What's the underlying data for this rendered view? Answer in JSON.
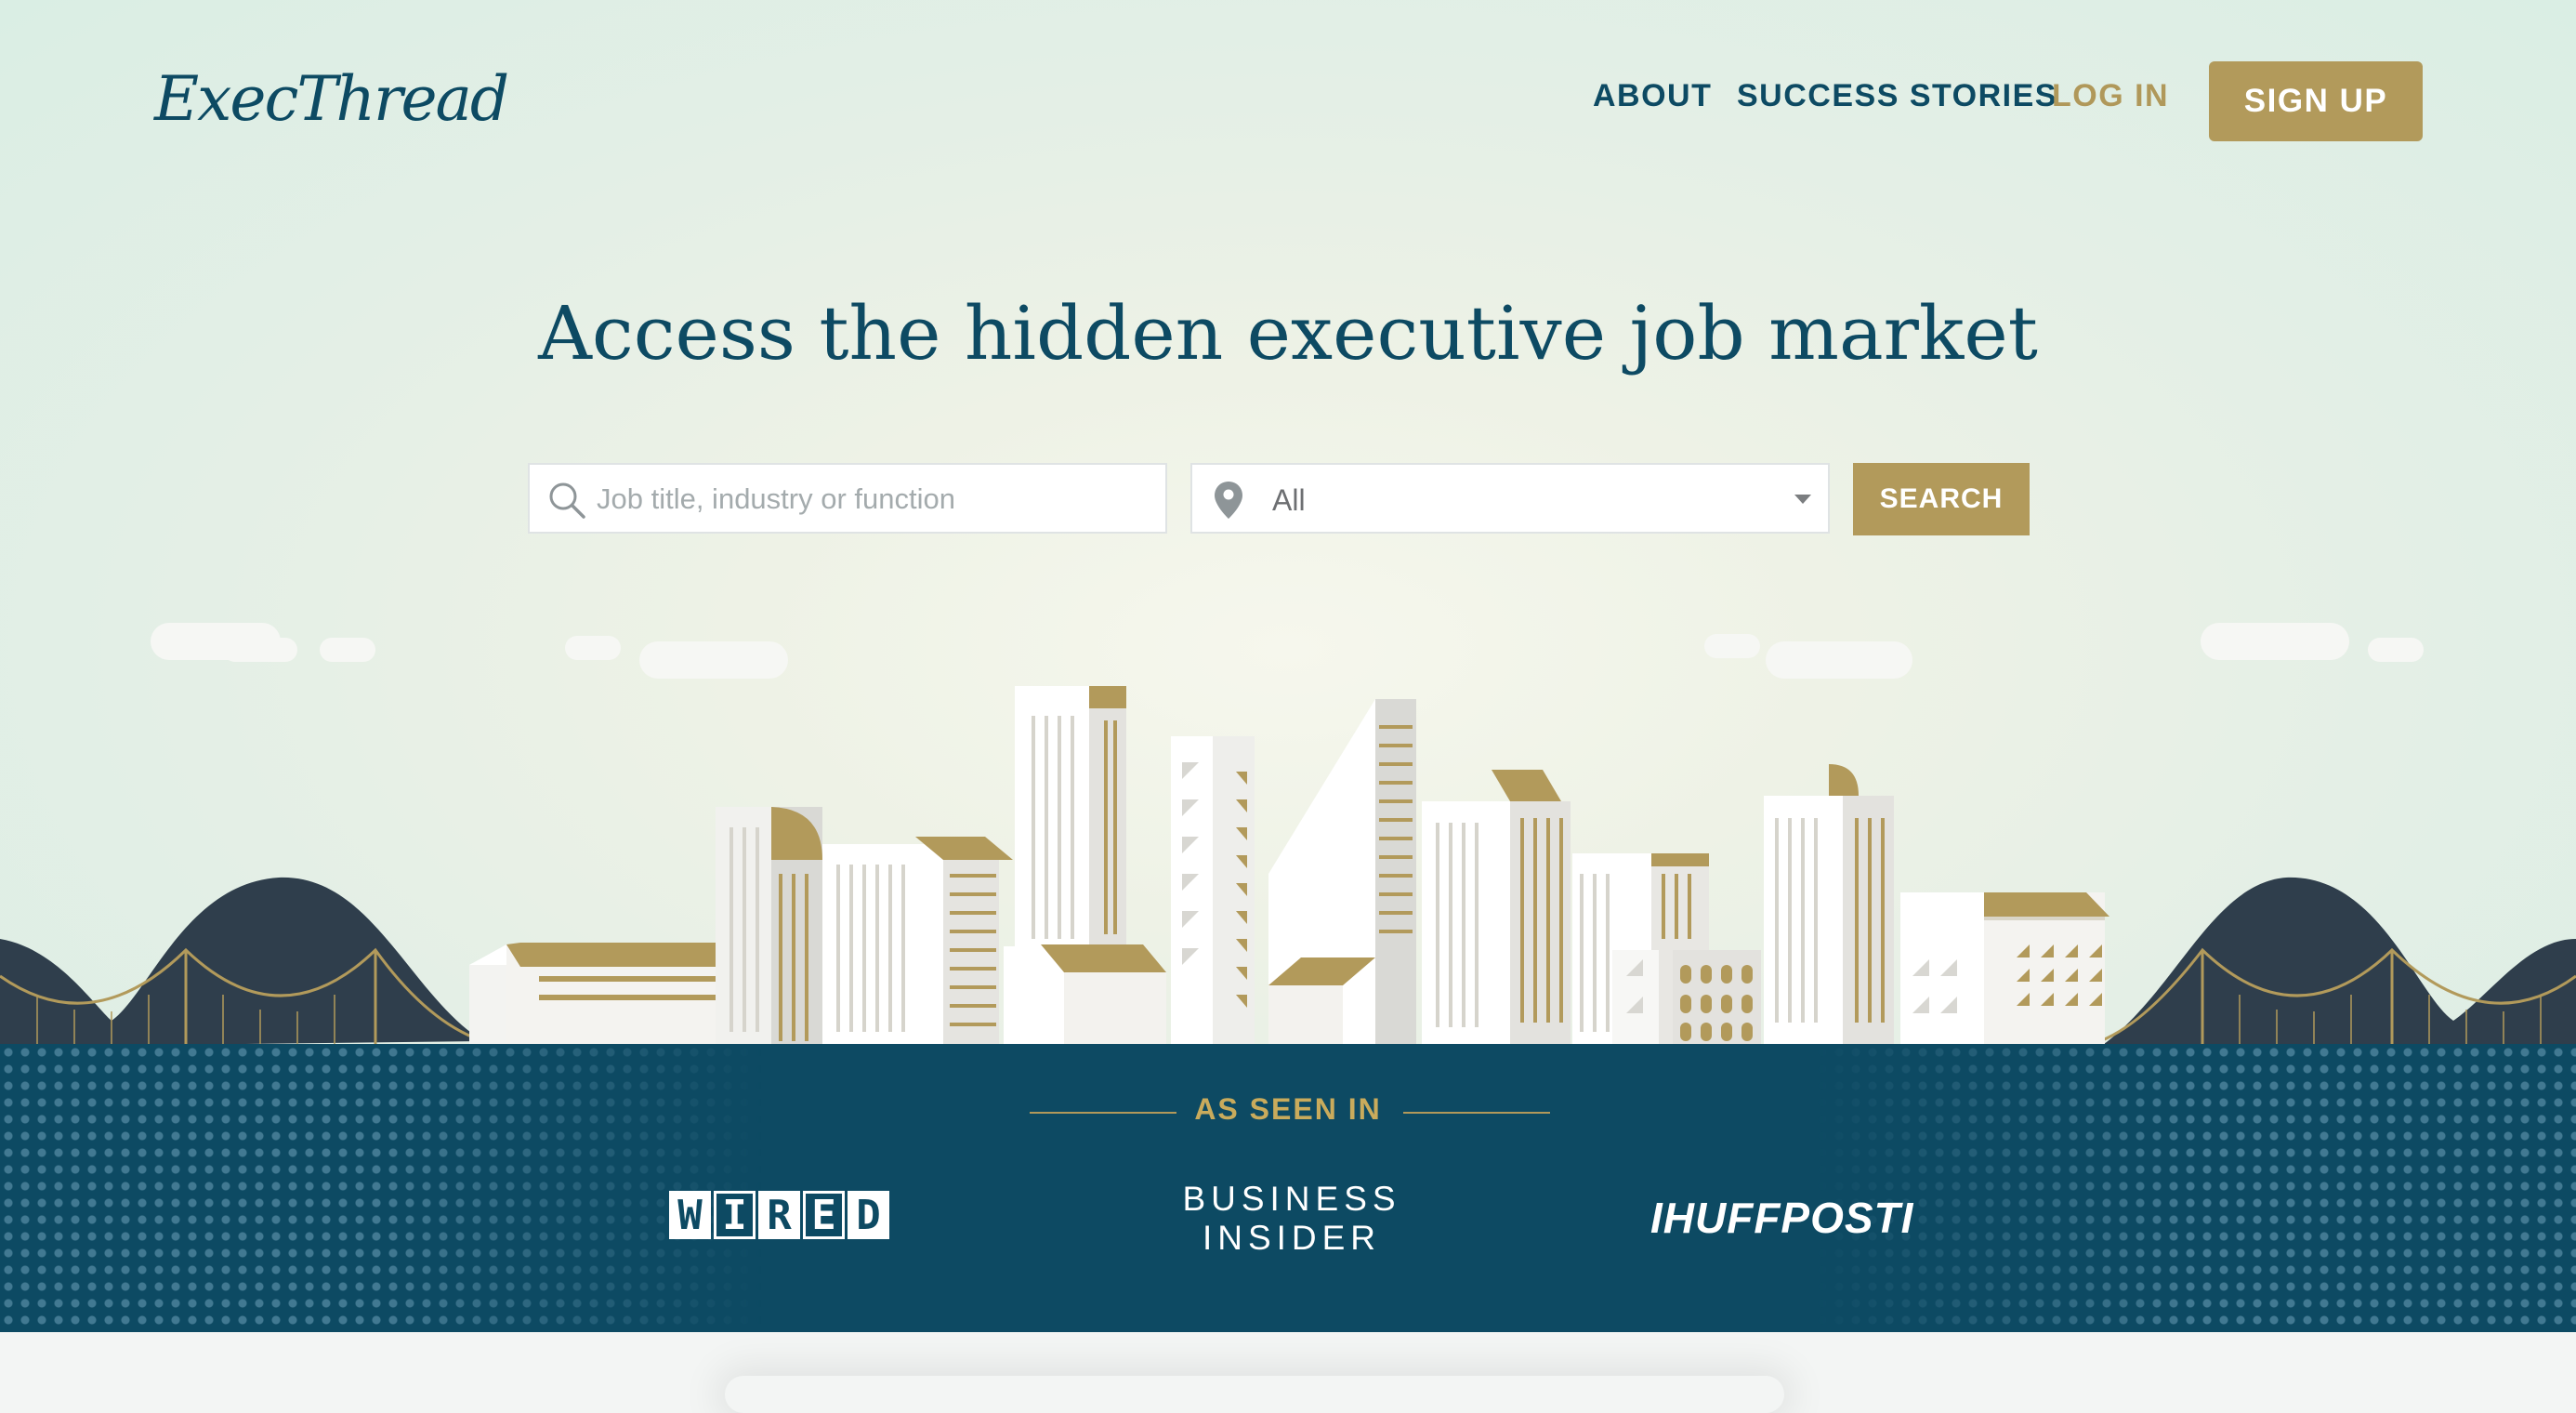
{
  "header": {
    "logo": "ExecThread",
    "nav": {
      "about": "ABOUT",
      "success_stories": "SUCCESS STORIES",
      "log_in": "LOG IN",
      "sign_up": "SIGN UP"
    }
  },
  "hero": {
    "headline": "Access the hidden executive job market",
    "search": {
      "placeholder": "Job title, industry or function",
      "location_value": "All",
      "button": "SEARCH"
    }
  },
  "press": {
    "label": "AS SEEN IN",
    "logos": {
      "wired": [
        "W",
        "I",
        "R",
        "E",
        "D"
      ],
      "business_insider_line1": "BUSINESS",
      "business_insider_line2": "INSIDER",
      "huffpost": "IHUFFPOSTI"
    }
  },
  "colors": {
    "brand_navy": "#0d4a63",
    "brand_gold": "#b29a5b",
    "background_mint": "#dcefe5"
  },
  "icons": {
    "search": "search-icon",
    "location": "map-pin-icon",
    "dropdown": "caret-down-icon"
  }
}
